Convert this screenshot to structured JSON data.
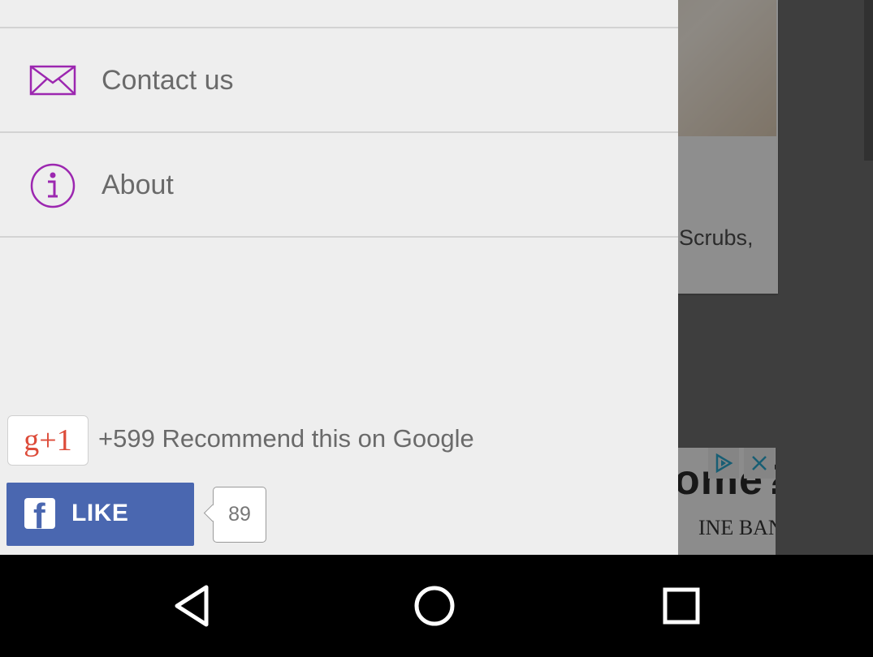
{
  "background": {
    "card_text": "Scrubs,",
    "ad": {
      "headline": "ome?",
      "subtitle": "INE BANK"
    }
  },
  "drawer": {
    "items": [
      {
        "label": "Contact us",
        "icon": "mail-icon"
      },
      {
        "label": "About",
        "icon": "info-icon"
      }
    ],
    "accent_color": "#9c27b0"
  },
  "social": {
    "gplus_badge": "g+1",
    "gplus_text": "+599 Recommend this on Google",
    "fb_like_label": "LIKE",
    "fb_like_count": "89",
    "fb_color": "#4a67b0"
  },
  "navbar": {
    "buttons": [
      "back",
      "home",
      "recents"
    ]
  }
}
